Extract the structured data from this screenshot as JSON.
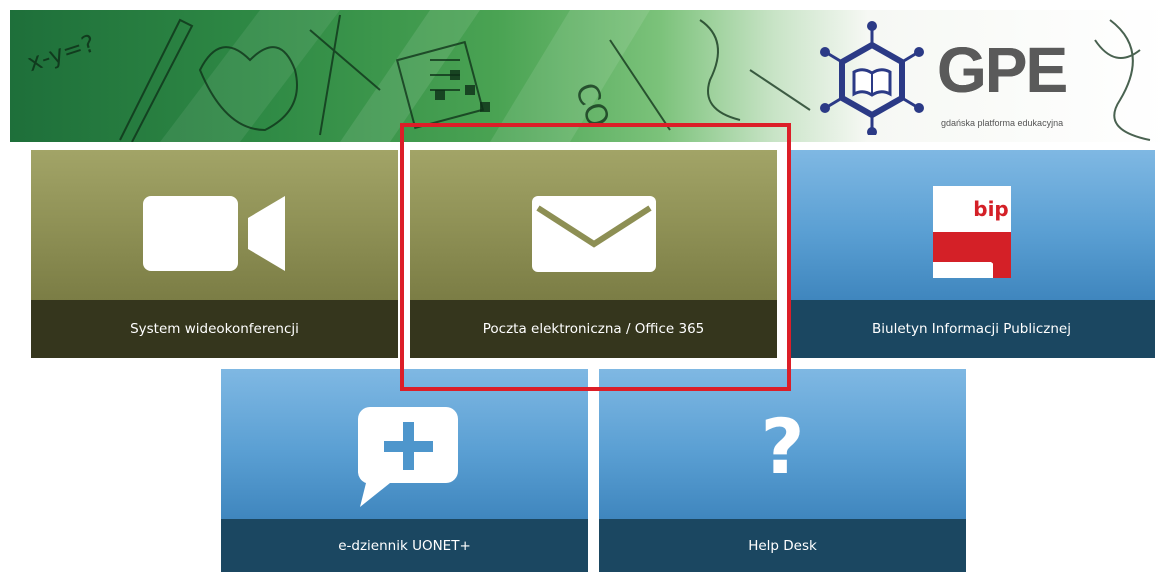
{
  "banner": {
    "logo_text": "GPE",
    "logo_subtitle": "gdańska platforma edukacyjna",
    "doodle_text_1": "x-y=?",
    "doodle_text_2": "CO"
  },
  "tiles": [
    {
      "label": "System wideokonferencji",
      "icon": "video-camera-icon",
      "theme": "olive"
    },
    {
      "label": "Poczta elektroniczna / Office 365",
      "icon": "envelope-icon",
      "theme": "olive"
    },
    {
      "label": "Biuletyn Informacji Publicznej",
      "icon": "bip-logo-icon",
      "icon_text": "bip",
      "theme": "blue"
    },
    {
      "label": "e-dziennik UONET+",
      "icon": "speech-bubble-plus-icon",
      "theme": "blue"
    },
    {
      "label": "Help Desk",
      "icon": "question-mark-icon",
      "icon_text": "?",
      "theme": "blue"
    }
  ],
  "colors": {
    "olive_top": "#a2a467",
    "olive_bar": "#35361d",
    "blue_top": "#7fb8e3",
    "blue_bar": "#1b4761",
    "highlight": "#dc1e28",
    "bip_red": "#d42027"
  }
}
